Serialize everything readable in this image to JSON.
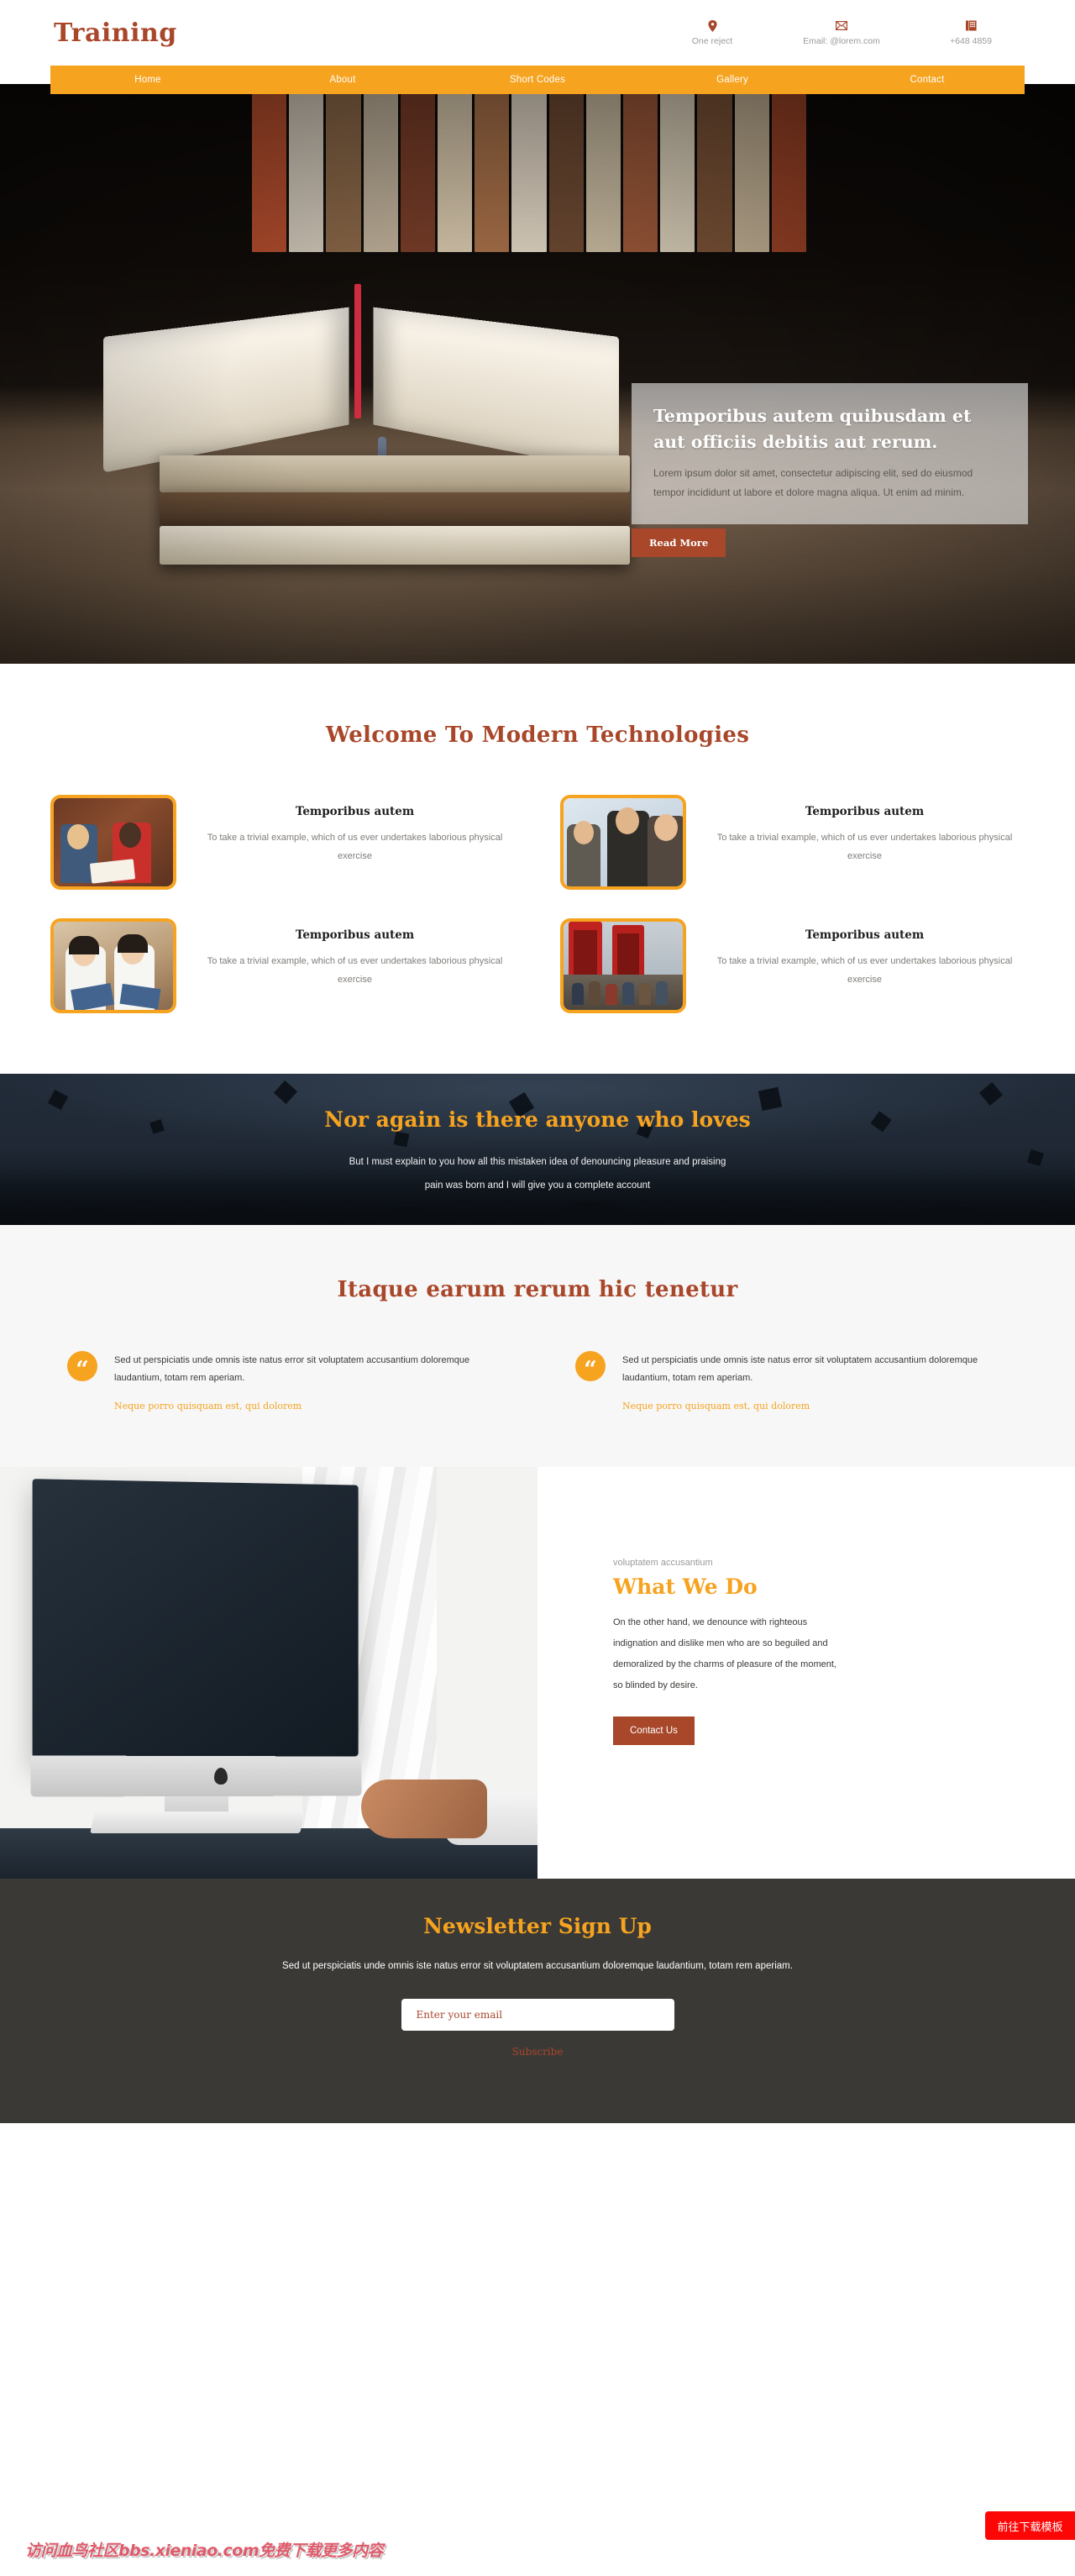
{
  "header": {
    "brand": "Training",
    "contacts": [
      {
        "icon": "location-pin-icon",
        "glyph": "⚉",
        "text": "One reject"
      },
      {
        "icon": "envelope-icon",
        "glyph": "✉",
        "text": "Email: @lorem.com"
      },
      {
        "icon": "telephone-icon",
        "glyph": "☎",
        "text": "+648 4859"
      }
    ]
  },
  "nav": {
    "items": [
      "Home",
      "About",
      "Short Codes",
      "Gallery",
      "Contact"
    ]
  },
  "hero": {
    "title": "Temporibus autem quibusdam et aut officiis debitis aut rerum.",
    "description": "Lorem ipsum dolor sit amet, consectetur adipiscing elit, sed do eiusmod tempor incididunt ut labore et dolore magna aliqua. Ut enim ad minim.",
    "button": "Read More"
  },
  "welcome": {
    "title": "Welcome To Modern Technologies",
    "features": [
      {
        "title": "Temporibus autem",
        "text": "To take a trivial example, which of us ever undertakes laborious physical exercise",
        "image": "students-reading-tablet"
      },
      {
        "title": "Temporibus autem",
        "text": "To take a trivial example, which of us ever undertakes laborious physical exercise",
        "image": "classroom-teacher-students"
      },
      {
        "title": "Temporibus autem",
        "text": "To take a trivial example, which of us ever undertakes laborious physical exercise",
        "image": "two-students-book"
      },
      {
        "title": "Temporibus autem",
        "text": "To take a trivial example, which of us ever undertakes laborious physical exercise",
        "image": "group-phone-booth"
      }
    ]
  },
  "banner": {
    "title": "Nor again is there anyone who loves",
    "line1": "But I must explain to you how all this mistaken idea of denouncing pleasure and praising",
    "line2": "pain was born and I will give you a complete account"
  },
  "testimonials": {
    "title": "Itaque earum rerum hic tenetur",
    "items": [
      {
        "quote_icon": "quote-mark-icon",
        "text": "Sed ut perspiciatis unde omnis iste natus error sit voluptatem accusantium doloremque laudantium, totam rem aperiam.",
        "author": "Neque porro quisquam est, qui dolorem"
      },
      {
        "quote_icon": "quote-mark-icon",
        "text": "Sed ut perspiciatis unde omnis iste natus error sit voluptatem accusantium doloremque laudantium, totam rem aperiam.",
        "author": "Neque porro quisquam est, qui dolorem"
      }
    ]
  },
  "what_we_do": {
    "eyebrow": "voluptatem accusantium",
    "title": "What We Do",
    "text": "On the other hand, we denounce with righteous indignation and dislike men who are so beguiled and demoralized by the charms of pleasure of the moment, so blinded by desire.",
    "button": "Contact Us",
    "image": "imac-desk-workspace"
  },
  "newsletter": {
    "title": "Newsletter Sign Up",
    "text": "Sed ut perspiciatis unde omnis iste natus error sit voluptatem accusantium doloremque laudantium, totam rem aperiam.",
    "email_placeholder": "Enter your email",
    "email_value": "",
    "subscribe": "Subscribe"
  },
  "overlays": {
    "watermark": "访问血鸟社区bbs.xieniao.com免费下载更多内容",
    "download_button": "前往下载模板"
  },
  "colors": {
    "brand_brown": "#a8472a",
    "accent_orange": "#f6a320",
    "dark_banner": "#1e2733",
    "footer_dark": "#3b3936",
    "download_red": "#fc0606"
  }
}
